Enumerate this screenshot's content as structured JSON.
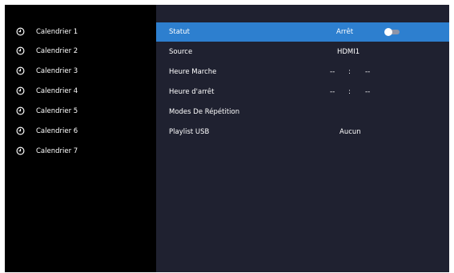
{
  "calendars": [
    {
      "label": "Calendrier 1",
      "icon": "clock-icon"
    },
    {
      "label": "Calendrier 2",
      "icon": "clock-icon"
    },
    {
      "label": "Calendrier 3",
      "icon": "clock-icon"
    },
    {
      "label": "Calendrier 4",
      "icon": "clock-icon"
    },
    {
      "label": "Calendrier 5",
      "icon": "clock-icon"
    },
    {
      "label": "Calendrier 6",
      "icon": "clock-icon"
    },
    {
      "label": "Calendrier 7",
      "icon": "clock-icon"
    }
  ],
  "settings": {
    "status": {
      "label": "Statut",
      "value": "Arrêt",
      "toggle_on": false
    },
    "source": {
      "label": "Source",
      "value": "HDMI1"
    },
    "start_time": {
      "label": "Heure Marche",
      "hours": "--",
      "separator": ":",
      "minutes": "--"
    },
    "stop_time": {
      "label": "Heure d'arrêt",
      "hours": "--",
      "separator": ":",
      "minutes": "--"
    },
    "repeat_modes": {
      "label": "Modes De Répétition"
    },
    "playlist_usb": {
      "label": "Playlist USB",
      "value": "Aucun"
    }
  },
  "colors": {
    "background": "#000000",
    "panel": "#1f2130",
    "selected": "#2d7fcf",
    "text": "#ffffff"
  }
}
